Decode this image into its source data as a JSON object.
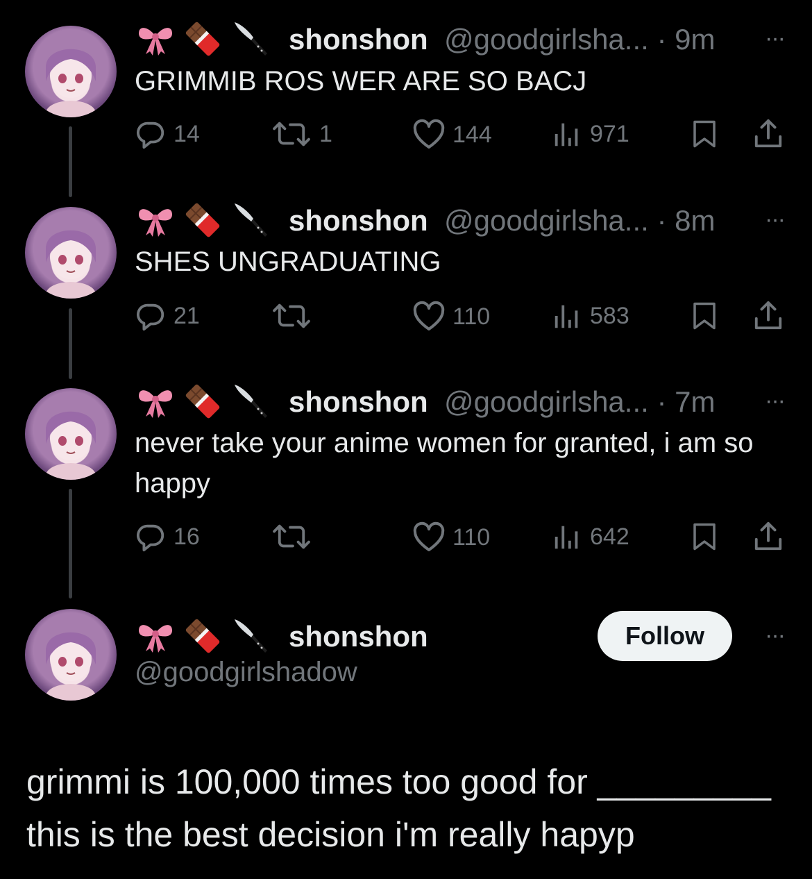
{
  "tweets": [
    {
      "display_name": "shonshon",
      "handle": "@goodgirlsha...",
      "time": "· 9m",
      "text": "GRIMMIB ROS WER ARE SO BACJ",
      "replies": "14",
      "reposts": "1",
      "likes": "144",
      "views": "971"
    },
    {
      "display_name": "shonshon",
      "handle": "@goodgirlsha...",
      "time": "· 8m",
      "text": "SHES UNGRADUATING",
      "replies": "21",
      "reposts": "",
      "likes": "110",
      "views": "583"
    },
    {
      "display_name": "shonshon",
      "handle": "@goodgirlsha...",
      "time": "· 7m",
      "text": "never take your anime women for granted, i am so happy",
      "replies": "16",
      "reposts": "",
      "likes": "110",
      "views": "642"
    }
  ],
  "main_tweet": {
    "display_name": "shonshon",
    "handle": "@goodgirlshadow",
    "follow_label": "Follow",
    "text_line1": "grimmi is 100,000 times too good for _________",
    "text_line2": "this is the best decision i'm  really hapyp"
  },
  "icons": {
    "name_emojis": [
      "ribbon-emoji",
      "chocolate-bar-emoji",
      "knife-emoji"
    ],
    "more": "more-icon",
    "reply": "reply-icon",
    "repost": "repost-icon",
    "like": "heart-icon",
    "views": "views-icon",
    "bookmark": "bookmark-icon",
    "share": "share-icon"
  },
  "more_glyph": "···",
  "colors": {
    "background": "#000000",
    "text": "#e7e9ea",
    "secondary": "#71767b",
    "follow_bg": "#eff3f4"
  }
}
